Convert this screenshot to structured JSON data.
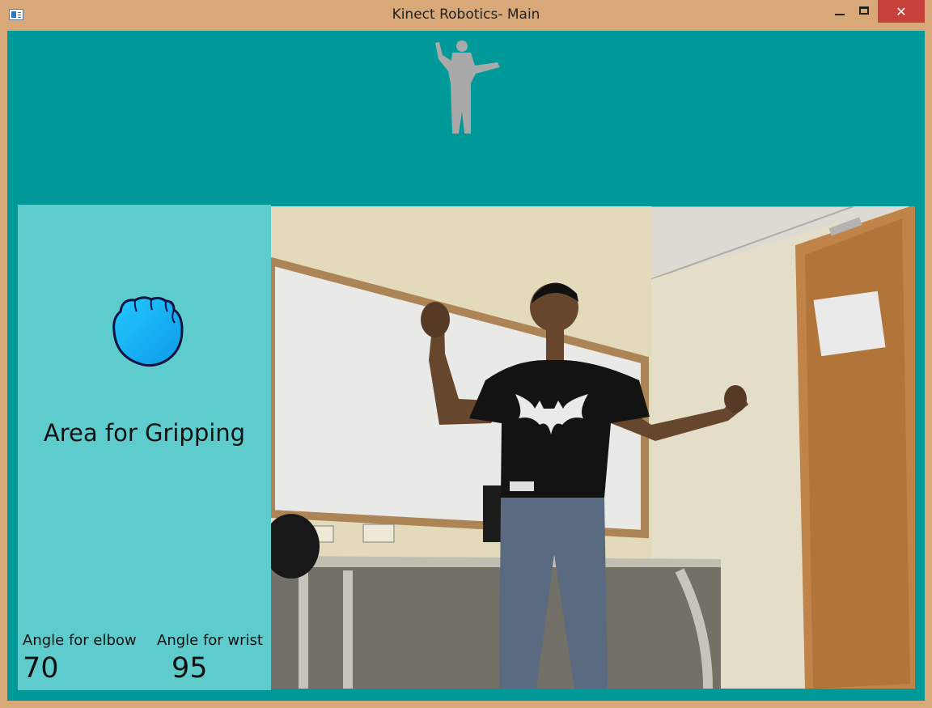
{
  "window": {
    "title": "Kinect Robotics- Main",
    "close_symbol": "✕"
  },
  "icons": {
    "app": "app-window-icon",
    "minimize": "minimize-icon",
    "maximize": "maximize-icon",
    "close": "close-icon",
    "grip_hand": "closed-hand-icon"
  },
  "colors": {
    "background": "#009999",
    "panel": "#5ecccc",
    "close_button": "#c7413b",
    "hand_fill": "#19b0ee"
  },
  "panel": {
    "grip_label": "Area for Gripping",
    "elbow_label": "Angle for elbow",
    "wrist_label": "Angle for wrist",
    "elbow_value": "70",
    "wrist_value": "95"
  }
}
